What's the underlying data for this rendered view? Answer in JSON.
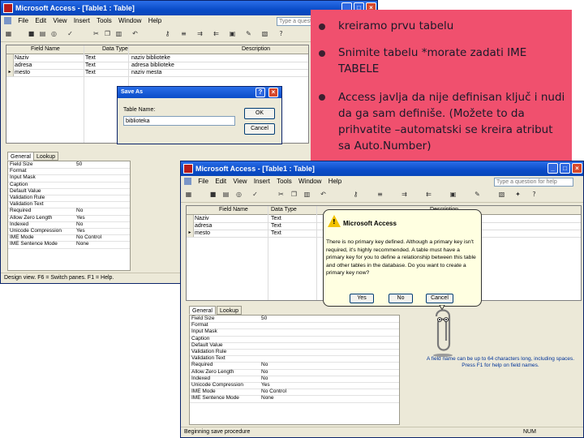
{
  "back_window": {
    "title": "Microsoft Access - [Table1 : Table]",
    "menu": [
      "File",
      "Edit",
      "View",
      "Insert",
      "Tools",
      "Window",
      "Help"
    ],
    "help_placeholder": "Type a quest",
    "grid_headers": [
      "Field Name",
      "Data Type",
      "Description"
    ],
    "rows": [
      {
        "name": "Naziv",
        "type": "Text",
        "desc": "naziv biblioteke"
      },
      {
        "name": "adresa",
        "type": "Text",
        "desc": "adresa biblioteke"
      },
      {
        "name": "mesto",
        "type": "Text",
        "desc": "naziv mesta"
      }
    ],
    "tabs": [
      "General",
      "Lookup"
    ],
    "props": [
      {
        "k": "Field Size",
        "v": "50"
      },
      {
        "k": "Format",
        "v": ""
      },
      {
        "k": "Input Mask",
        "v": ""
      },
      {
        "k": "Caption",
        "v": ""
      },
      {
        "k": "Default Value",
        "v": ""
      },
      {
        "k": "Validation Rule",
        "v": ""
      },
      {
        "k": "Validation Text",
        "v": ""
      },
      {
        "k": "Required",
        "v": "No"
      },
      {
        "k": "Allow Zero Length",
        "v": "Yes"
      },
      {
        "k": "Indexed",
        "v": "No"
      },
      {
        "k": "Unicode Compression",
        "v": "Yes"
      },
      {
        "k": "IME Mode",
        "v": "No Control"
      },
      {
        "k": "IME Sentence Mode",
        "v": "None"
      }
    ],
    "status": "Design view. F6 = Switch panes. F1 = Help."
  },
  "save_dialog": {
    "title": "Save As",
    "label": "Table Name:",
    "value": "biblioteka",
    "ok": "OK",
    "cancel": "Cancel",
    "help_glyph": "?",
    "close_glyph": "×"
  },
  "slide_bullets": [
    "kreiramo prvu tabelu",
    "Snimite tabelu  *morate zadati IME TABELE",
    "Access javlja da nije definisan ključ i nudi da ga sam definiše.  (Možete to da prihvatite –automatski se kreira atribut sa Auto.Number)"
  ],
  "front_window": {
    "title": "Microsoft Access - [Table1 : Table]",
    "menu": [
      "File",
      "Edit",
      "View",
      "Insert",
      "Tools",
      "Window",
      "Help"
    ],
    "help_placeholder": "Type a question for help",
    "grid_headers": [
      "Field Name",
      "Data Type",
      "Description"
    ],
    "rows": [
      {
        "name": "Naziv",
        "type": "Text"
      },
      {
        "name": "adresa",
        "type": "Text"
      },
      {
        "name": "mesto",
        "type": "Text"
      }
    ],
    "tabs": [
      "General",
      "Lookup"
    ],
    "props": [
      {
        "k": "Field Size",
        "v": "50"
      },
      {
        "k": "Format",
        "v": ""
      },
      {
        "k": "Input Mask",
        "v": ""
      },
      {
        "k": "Caption",
        "v": ""
      },
      {
        "k": "Default Value",
        "v": ""
      },
      {
        "k": "Validation Rule",
        "v": ""
      },
      {
        "k": "Validation Text",
        "v": ""
      },
      {
        "k": "Required",
        "v": "No"
      },
      {
        "k": "Allow Zero Length",
        "v": "No"
      },
      {
        "k": "Indexed",
        "v": "No"
      },
      {
        "k": "Unicode Compression",
        "v": "Yes"
      },
      {
        "k": "IME Mode",
        "v": "No Control"
      },
      {
        "k": "IME Sentence Mode",
        "v": "None"
      }
    ],
    "hint": "A field name can be up to 64 characters long, including spaces. Press F1 for help on field names.",
    "status": "Beginning save procedure",
    "status_num": "NUM"
  },
  "balloon": {
    "title": "Microsoft Access",
    "message": "There is no primary key defined. Although a primary key isn't required, it's highly recommended. A table must have a primary key for you to define a relationship between this table and other tables in the database. Do you want to create a primary key now?",
    "yes": "Yes",
    "no": "No",
    "cancel": "Cancel"
  },
  "colors": {
    "pink": "#f0506e",
    "titlebar": "#0a4cc8",
    "balloon": "#ffffe1"
  }
}
